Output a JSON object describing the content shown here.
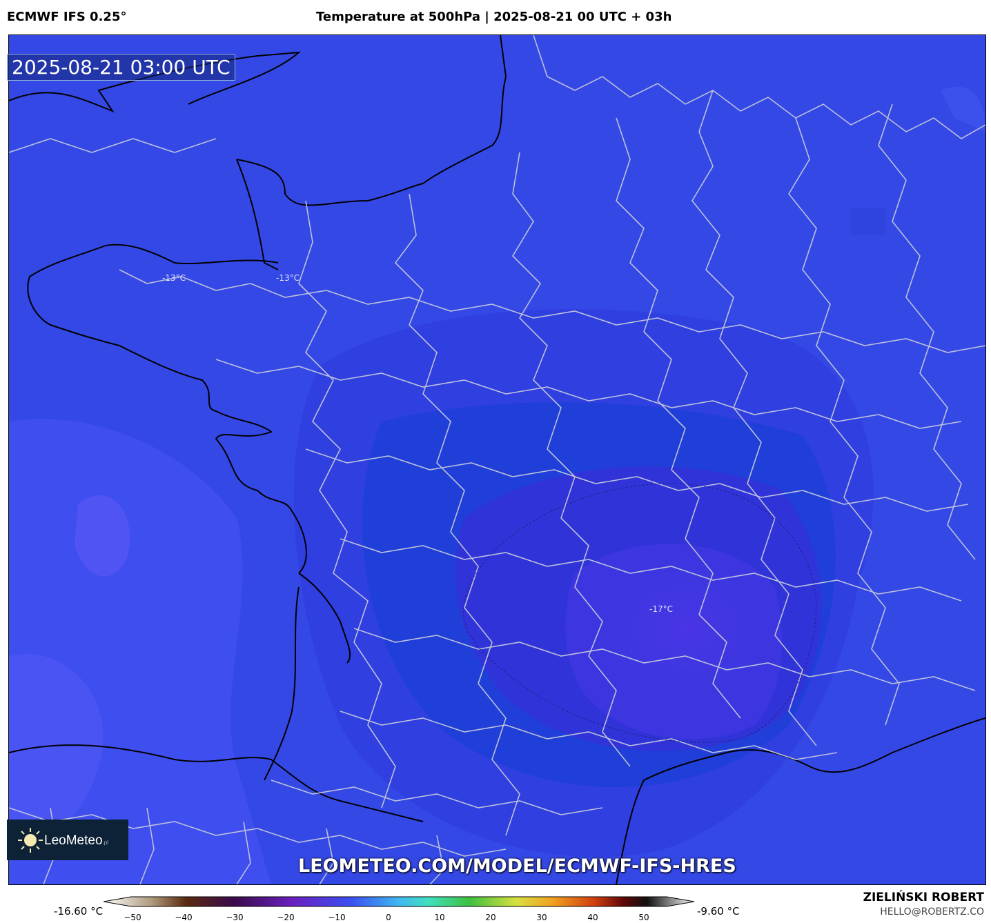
{
  "header": {
    "model": "ECMWF IFS 0.25°",
    "title": "Temperature at 500hPa | 2025-08-21 00 UTC + 03h"
  },
  "map": {
    "valid_time": "2025-08-21 03:00 UTC",
    "labels": [
      {
        "text": "-13°C",
        "region": "brittany"
      },
      {
        "text": "-13°C",
        "region": "normandy"
      },
      {
        "text": "-17°C",
        "region": "central-massif"
      }
    ],
    "watermark": "LEOMETEO.COM/MODEL/ECMWF-IFS-HRES",
    "logo": {
      "name": "LeoMeteo",
      "suffix": ".pl"
    }
  },
  "colorbar": {
    "min_label": "-16.60 °C",
    "max_label": "-9.60 °C",
    "ticks": [
      "−50",
      "−40",
      "−30",
      "−20",
      "−10",
      "0",
      "10",
      "20",
      "30",
      "40",
      "50"
    ]
  },
  "credits": {
    "author": "ZIELIŃSKI ROBERT",
    "email": "HELLO@ROBERTZ.CO"
  },
  "colors": {
    "ocean": "#3a52e8",
    "cold_core": "#4a2fe0",
    "border": "#c8c8d8",
    "coast": "#000000"
  }
}
